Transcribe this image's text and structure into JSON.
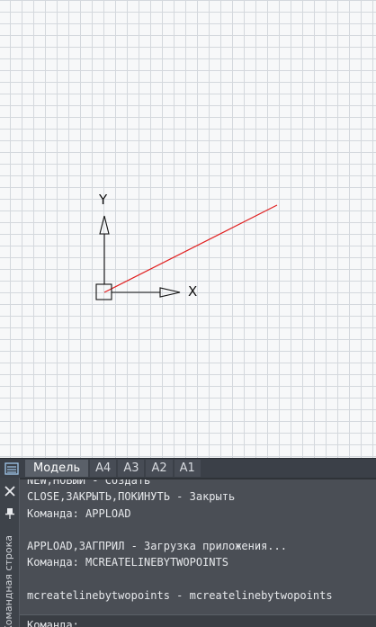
{
  "drawing": {
    "ucs_x_label": "X",
    "ucs_y_label": "Y",
    "line_color": "#e02020"
  },
  "tabs": [
    "Модель",
    "A4",
    "A3",
    "A2",
    "A1"
  ],
  "active_tab": 0,
  "command_panel": {
    "title": "Командная строка",
    "history": [
      "NEW,НОВЫЙ - Создать",
      "CLOSE,ЗАКРЫТЬ,ПОКИНУТЬ - Закрыть",
      "Команда: APPLOAD",
      "",
      "APPLOAD,ЗАГПРИЛ - Загрузка приложения...",
      "Команда: MCREATELINEBYTWOPOINTS",
      "",
      "mcreatelinebytwopoints - mcreatelinebytwopoints"
    ],
    "prompt": "Команда:"
  }
}
